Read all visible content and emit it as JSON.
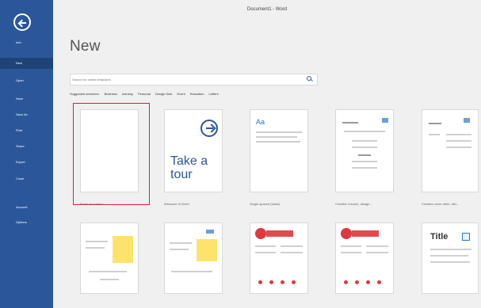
{
  "window": {
    "title": "Document1 - Word"
  },
  "sidebar": {
    "items": [
      {
        "label": "Info"
      },
      {
        "label": "New"
      },
      {
        "label": "Open"
      },
      {
        "label": "Save"
      },
      {
        "label": "Save As"
      },
      {
        "label": "Print"
      },
      {
        "label": "Share"
      },
      {
        "label": "Export"
      },
      {
        "label": "Close"
      },
      {
        "label": "Account"
      },
      {
        "label": "Options"
      }
    ]
  },
  "main": {
    "title": "New",
    "search": {
      "placeholder": "Search for online templates"
    },
    "categories": [
      "Suggested searches:",
      "Business",
      "Industry",
      "Personal",
      "Design Sets",
      "Event",
      "Education",
      "Letters"
    ],
    "templates": [
      {
        "caption": "Blank document"
      },
      {
        "caption": "Welcome to Word",
        "text_line1": "Take a",
        "text_line2": "tour"
      },
      {
        "caption": "Single spaced (blank)",
        "text": "Aa"
      },
      {
        "caption": "Creative resume, design..."
      },
      {
        "caption": "Creative cover letter, des..."
      },
      {
        "text": "Title"
      }
    ]
  },
  "colors": {
    "sidebar": "#2b579a",
    "selection": "#d9232e",
    "accent_red": "#e0383e",
    "accent_yellow": "#fde36b"
  }
}
